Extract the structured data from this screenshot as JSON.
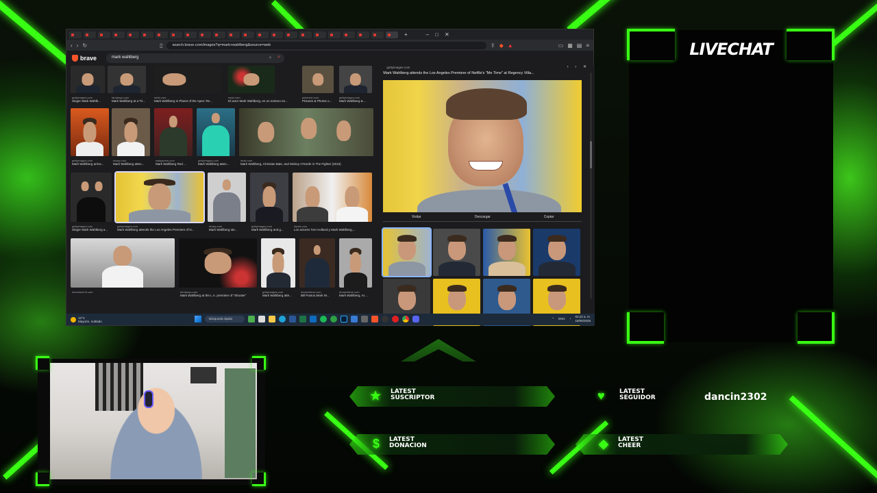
{
  "browser": {
    "url": "search.brave.com/images?q=mark+wahlberg&source=web",
    "brand": "brave",
    "search_query": "mark wahlberg",
    "tab_count": 23,
    "grid_rows": [
      {
        "items": [
          {
            "source": "gettyimages.com",
            "caption": "Singer Mark Wahlb..."
          },
          {
            "source": "fandango.com",
            "caption": "Mark Wahlberg at a Tri..."
          },
          {
            "source": "imdb.com",
            "caption": "Mark Wahlberg in Planet of the Apes: Re..."
          },
          {
            "source": "eepe.com",
            "caption": "El actor Mark Wahlberg, en un extreno en..."
          },
          {
            "source": "pinterest.com",
            "caption": "Pictures & Photos o..."
          },
          {
            "source": "gettyimages.com",
            "caption": "Mark Wahlberg & ..."
          }
        ]
      },
      {
        "items": [
          {
            "source": "gettyimages.com",
            "caption": "Mark Wahlberg arrive..."
          },
          {
            "source": "ebaey.com",
            "caption": "Mark Wahlberg atten..."
          },
          {
            "source": "wallpapers.com",
            "caption": "Mark Wahlberg Red ..."
          },
          {
            "source": "gettyimages.com",
            "caption": "Mark Wahlberg atten..."
          },
          {
            "source": "imdb.com",
            "caption": "Mark Wahlberg, Christian Bale, and Mickey O'Keefe in The Fighter (2010)"
          }
        ]
      },
      {
        "items": [
          {
            "source": "gettyimages.com",
            "caption": "Singer Mark Wahlberg a..."
          },
          {
            "source": "gettyimages.com",
            "caption": "Mark Wahlberg attends the Los Angeles Premiere of N..."
          },
          {
            "source": "ebaey.com",
            "caption": "Mark Wahlberg ste..."
          },
          {
            "source": "gettyimages.com",
            "caption": "Mark Wahlberg and g..."
          },
          {
            "source": "elpais.com",
            "caption": "Los actores Tom Holland y Mark Wahlberg,..."
          }
        ]
      },
      {
        "items": [
          {
            "source": "mensheal th.com",
            "caption": ""
          },
          {
            "source": "fandango.com",
            "caption": "Mark Wahlberg at the L.A. premiere of \"Shooter\""
          },
          {
            "source": "gettyimages.com",
            "caption": "Mark Wahlberg atte..."
          },
          {
            "source": "dreamstime.com",
            "caption": "Bill Paxton,Mark W..."
          },
          {
            "source": "dreamstime.com",
            "caption": "Mark Wahlberg, At ..."
          }
        ]
      }
    ],
    "preview": {
      "source": "gettyimages.com",
      "title": "Mark Wahlberg attends the Los Angeles Premiere of Netflix's \"Me Time\" at Regency Villa...",
      "actions": [
        "Visitar",
        "Descargar",
        "Copiar"
      ],
      "controls": "‹ › ✕"
    },
    "taskbar": {
      "weather_temp": "12°C",
      "weather_desc": "Mayorm. nublado",
      "search_placeholder": "Búsqueda rápida",
      "lang": "ENG",
      "time": "02:22 a. m.",
      "date": "18/06/2025"
    }
  },
  "livechat": {
    "title": "LIVECHAT"
  },
  "alerts": {
    "suscriptor": {
      "line1": "LATEST",
      "line2": "SUSCRIPTOR",
      "value": ""
    },
    "seguidor": {
      "line1": "LATEST",
      "line2": "SEGUIDOR",
      "value": "dancin2302"
    },
    "donacion": {
      "line1": "LATEST",
      "line2": "DONACION",
      "value": ""
    },
    "cheer": {
      "line1": "LATEST",
      "line2": "CHEER",
      "value": ""
    }
  },
  "colors": {
    "accent": "#39ff14",
    "brave": "#fb542b",
    "bg": "#050a05"
  }
}
